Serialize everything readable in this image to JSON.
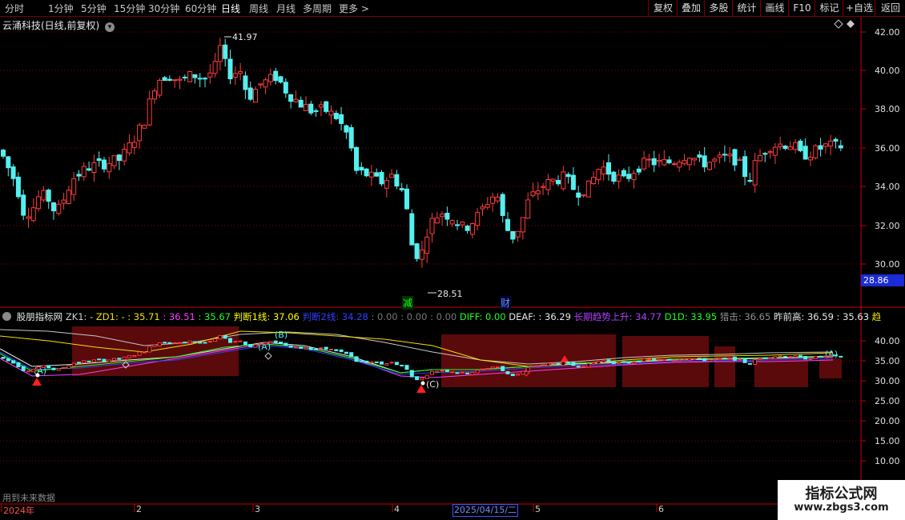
{
  "topbar": {
    "periods": [
      "分时",
      "1分钟",
      "5分钟",
      "15分钟",
      "30分钟",
      "60分钟",
      "日线",
      "周线",
      "月线",
      "多周期",
      "更多 >"
    ],
    "active_period": "日线",
    "tools": [
      "复权",
      "叠加",
      "多股",
      "统计",
      "画线",
      "F10",
      "标记",
      "+自选",
      "返回"
    ]
  },
  "stock": {
    "name_line": "云涌科技(日线,前复权)",
    "high_label": "41.97",
    "low_label": "28.51",
    "current_price_tag": "28.86",
    "marker_jian": "减",
    "marker_cai": "财"
  },
  "price_axis": [
    "42.00",
    "40.00",
    "38.00",
    "36.00",
    "34.00",
    "32.00",
    "30.00"
  ],
  "indicator": {
    "name": "股朋指标网",
    "items": [
      {
        "text": "ZK1: -",
        "color": "#d0d0d0"
      },
      {
        "text": "ZD1: - : 35.71",
        "color": "#f0e000"
      },
      {
        "text": ": 36.51",
        "color": "#ff3cff"
      },
      {
        "text": ": 35.67",
        "color": "#20ff20"
      },
      {
        "text": "判断1线: 37.06",
        "color": "#ffff00"
      },
      {
        "text": "判断2线: 34.28",
        "color": "#3040ff"
      },
      {
        "text": ": 0.00 : 0.00 : 0.00",
        "color": "#777777"
      },
      {
        "text": "DIFF: 0.00",
        "color": "#20ff20"
      },
      {
        "text": "DEAF: : 36.29",
        "color": "#e8e8e8"
      },
      {
        "text": "长期趋势上升: 34.77",
        "color": "#b040ff"
      },
      {
        "text": "D1D: 33.95",
        "color": "#20ff20"
      },
      {
        "text": "猎击: 36.65",
        "color": "#909090"
      },
      {
        "text": "昨前高: 36.59 : 35.63",
        "color": "#e8e8e8"
      },
      {
        "text": "趋",
        "color": "#f0e000"
      }
    ],
    "axis": [
      "40.00",
      "35.00",
      "30.00",
      "25.00",
      "20.00",
      "15.00",
      "10.00"
    ],
    "labels": {
      "a1": "(A)",
      "b1": "(B)",
      "c1": "(C)",
      "a2": "(A)",
      "c2": "(C)",
      "a3": "(A)"
    }
  },
  "footer": {
    "note": "用到未来数据",
    "dates": [
      "2024年",
      "2",
      "3",
      "4",
      "5",
      "6"
    ],
    "selected_date": "2025/04/15/二"
  },
  "watermark": {
    "line1": "指标公式网",
    "line2": "www.zbgs3.com"
  },
  "colors": {
    "up": "#ff3b3b",
    "down": "#54f0f0",
    "grid": "#8a0000",
    "axis": "#c80000"
  }
}
